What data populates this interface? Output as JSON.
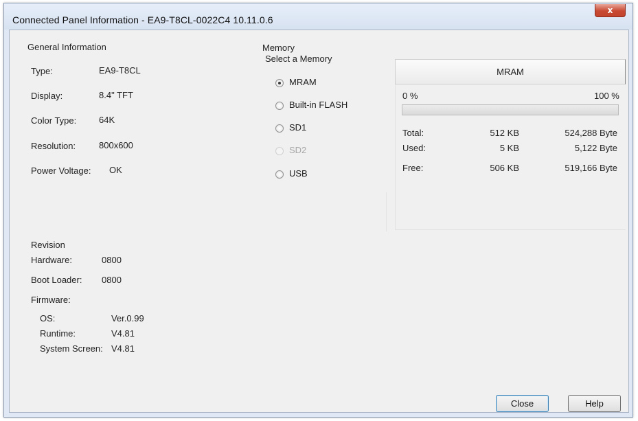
{
  "window": {
    "title": "Connected Panel Information - EA9-T8CL-0022C4 10.11.0.6",
    "close_glyph": "x"
  },
  "general": {
    "heading": "General Information",
    "rows": [
      {
        "label": "Type:",
        "value": "EA9-T8CL"
      },
      {
        "label": "Display:",
        "value": "8.4\" TFT"
      },
      {
        "label": "Color Type:",
        "value": "64K"
      },
      {
        "label": "Resolution:",
        "value": "800x600"
      },
      {
        "label": "Power Voltage:",
        "value": "OK"
      }
    ]
  },
  "revision": {
    "heading": "Revision",
    "hardware_label": "Hardware:",
    "hardware_value": "0800",
    "bootloader_label": "Boot Loader:",
    "bootloader_value": "0800",
    "firmware_label": "Firmware:",
    "firmware": [
      {
        "label": "OS:",
        "value": "Ver.0.99"
      },
      {
        "label": "Runtime:",
        "value": "V4.81"
      },
      {
        "label": "System Screen:",
        "value": "V4.81"
      }
    ]
  },
  "memory": {
    "heading": "Memory",
    "select_label": "Select a Memory",
    "options": [
      {
        "label": "MRAM",
        "checked": true,
        "disabled": false
      },
      {
        "label": "Built-in FLASH",
        "checked": false,
        "disabled": false
      },
      {
        "label": "SD1",
        "checked": false,
        "disabled": false
      },
      {
        "label": "SD2",
        "checked": false,
        "disabled": true
      },
      {
        "label": "USB",
        "checked": false,
        "disabled": false
      }
    ],
    "selected_name": "MRAM",
    "progress_min_label": "0 %",
    "progress_max_label": "100 %",
    "used_fraction": 0.0,
    "stats": [
      {
        "label": "Total:",
        "kb": "512 KB",
        "bytes": "524,288 Byte"
      },
      {
        "label": "Used:",
        "kb": "5 KB",
        "bytes": "5,122 Byte"
      },
      {
        "label": "Free:",
        "kb": "506 KB",
        "bytes": "519,166 Byte"
      }
    ]
  },
  "buttons": {
    "close_label": "Close",
    "help_label": "Help"
  }
}
